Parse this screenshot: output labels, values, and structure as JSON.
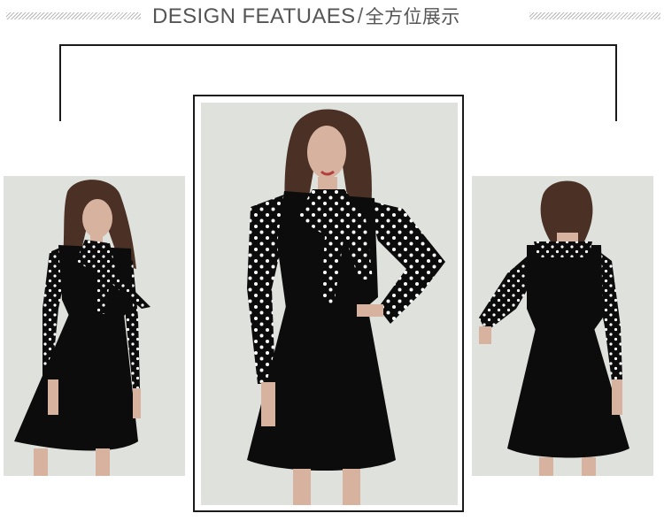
{
  "header": {
    "title_en": "DESIGN  FEATUAES",
    "title_separator": "/",
    "title_cn": "全方位展示"
  },
  "photos": [
    {
      "view": "front three-quarter",
      "icon": "dress-model-photo"
    },
    {
      "view": "front",
      "icon": "dress-model-photo"
    },
    {
      "view": "back",
      "icon": "dress-model-photo"
    }
  ],
  "colors": {
    "background": "#ffffff",
    "photo_background": "#dfe1dd",
    "dress": "#0c0c0c",
    "dots": "#ffffff",
    "skin": "#d7b39f",
    "hair": "#4a3025",
    "frame": "#1a1a1a"
  }
}
